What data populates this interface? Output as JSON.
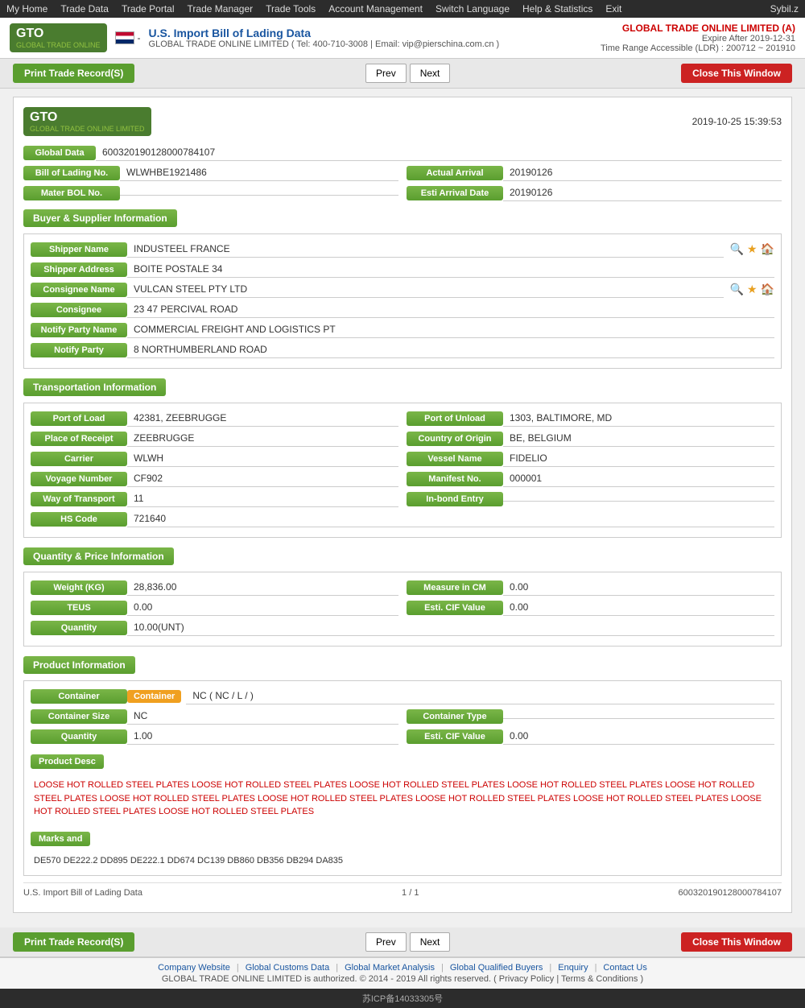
{
  "topnav": {
    "items": [
      "My Home",
      "Trade Data",
      "Trade Portal",
      "Trade Manager",
      "Trade Tools",
      "Account Management",
      "Switch Language",
      "Help & Statistics",
      "Exit"
    ],
    "user": "Sybil.z"
  },
  "header": {
    "title": "U.S. Import Bill of Lading Data",
    "contact": "GLOBAL TRADE ONLINE LIMITED ( Tel: 400-710-3008 | Email: vip@pierschina.com.cn )",
    "company": "GLOBAL TRADE ONLINE LIMITED (A)",
    "expire": "Expire After 2019-12-31",
    "range": "Time Range Accessible (LDR) : 200712 ~ 201910"
  },
  "toolbar": {
    "print_label": "Print Trade Record(S)",
    "prev_label": "Prev",
    "next_label": "Next",
    "close_label": "Close This Window"
  },
  "record": {
    "timestamp": "2019-10-25 15:39:53",
    "global_data_label": "Global Data",
    "global_data_value": "600320190128000784107",
    "bol_label": "Bill of Lading No.",
    "bol_value": "WLWHBE1921486",
    "actual_arrival_label": "Actual Arrival",
    "actual_arrival_value": "20190126",
    "mater_bol_label": "Mater BOL No.",
    "mater_bol_value": "",
    "esti_arrival_label": "Esti Arrival Date",
    "esti_arrival_value": "20190126"
  },
  "buyer_supplier": {
    "section_title": "Buyer & Supplier Information",
    "shipper_name_label": "Shipper Name",
    "shipper_name_value": "INDUSTEEL FRANCE",
    "shipper_address_label": "Shipper Address",
    "shipper_address_value": "BOITE POSTALE 34",
    "consignee_name_label": "Consignee Name",
    "consignee_name_value": "VULCAN STEEL PTY LTD",
    "consignee_label": "Consignee",
    "consignee_value": "23 47 PERCIVAL ROAD",
    "notify_party_name_label": "Notify Party Name",
    "notify_party_name_value": "COMMERCIAL FREIGHT AND LOGISTICS PT",
    "notify_party_label": "Notify Party",
    "notify_party_value": "8 NORTHUMBERLAND ROAD"
  },
  "transportation": {
    "section_title": "Transportation Information",
    "port_of_load_label": "Port of Load",
    "port_of_load_value": "42381, ZEEBRUGGE",
    "port_of_unload_label": "Port of Unload",
    "port_of_unload_value": "1303, BALTIMORE, MD",
    "place_of_receipt_label": "Place of Receipt",
    "place_of_receipt_value": "ZEEBRUGGE",
    "country_of_origin_label": "Country of Origin",
    "country_of_origin_value": "BE, BELGIUM",
    "carrier_label": "Carrier",
    "carrier_value": "WLWH",
    "vessel_name_label": "Vessel Name",
    "vessel_name_value": "FIDELIO",
    "voyage_number_label": "Voyage Number",
    "voyage_number_value": "CF902",
    "manifest_no_label": "Manifest No.",
    "manifest_no_value": "000001",
    "way_of_transport_label": "Way of Transport",
    "way_of_transport_value": "11",
    "in_bond_entry_label": "In-bond Entry",
    "in_bond_entry_value": "",
    "hs_code_label": "HS Code",
    "hs_code_value": "721640"
  },
  "quantity_price": {
    "section_title": "Quantity & Price Information",
    "weight_label": "Weight (KG)",
    "weight_value": "28,836.00",
    "measure_cm_label": "Measure in CM",
    "measure_cm_value": "0.00",
    "teus_label": "TEUS",
    "teus_value": "0.00",
    "esti_cif_label": "Esti. CIF Value",
    "esti_cif_value": "0.00",
    "quantity_label": "Quantity",
    "quantity_value": "10.00(UNT)"
  },
  "product_info": {
    "section_title": "Product Information",
    "container_label": "Container",
    "container_tag": "Container",
    "container_value": "NC ( NC / L / )",
    "container_size_label": "Container Size",
    "container_size_value": "NC",
    "container_type_label": "Container Type",
    "container_type_value": "",
    "quantity_label": "Quantity",
    "quantity_value": "1.00",
    "esti_cif_label": "Esti. CIF Value",
    "esti_cif_value": "0.00",
    "product_desc_label": "Product Desc",
    "product_desc_text": "LOOSE HOT ROLLED STEEL PLATES LOOSE HOT ROLLED STEEL PLATES LOOSE HOT ROLLED STEEL PLATES LOOSE HOT ROLLED STEEL PLATES LOOSE HOT ROLLED STEEL PLATES LOOSE HOT ROLLED STEEL PLATES LOOSE HOT ROLLED STEEL PLATES LOOSE HOT ROLLED STEEL PLATES LOOSE HOT ROLLED STEEL PLATES LOOSE HOT ROLLED STEEL PLATES LOOSE HOT ROLLED STEEL PLATES",
    "marks_label": "Marks and",
    "marks_value": "DE570 DE222.2 DD895 DE222.1 DD674 DC139 DB860 DB356 DB294 DA835"
  },
  "record_footer": {
    "source": "U.S. Import Bill of Lading Data",
    "page": "1 / 1",
    "id": "600320190128000784107"
  },
  "page_footer": {
    "links": [
      "Company Website",
      "Global Customs Data",
      "Global Market Analysis",
      "Global Qualified Buyers",
      "Enquiry",
      "Contact Us"
    ],
    "copyright": "GLOBAL TRADE ONLINE LIMITED is authorized. © 2014 - 2019 All rights reserved. ( Privacy Policy | Terms & Conditions )",
    "beian": "苏ICP备14033305号"
  }
}
